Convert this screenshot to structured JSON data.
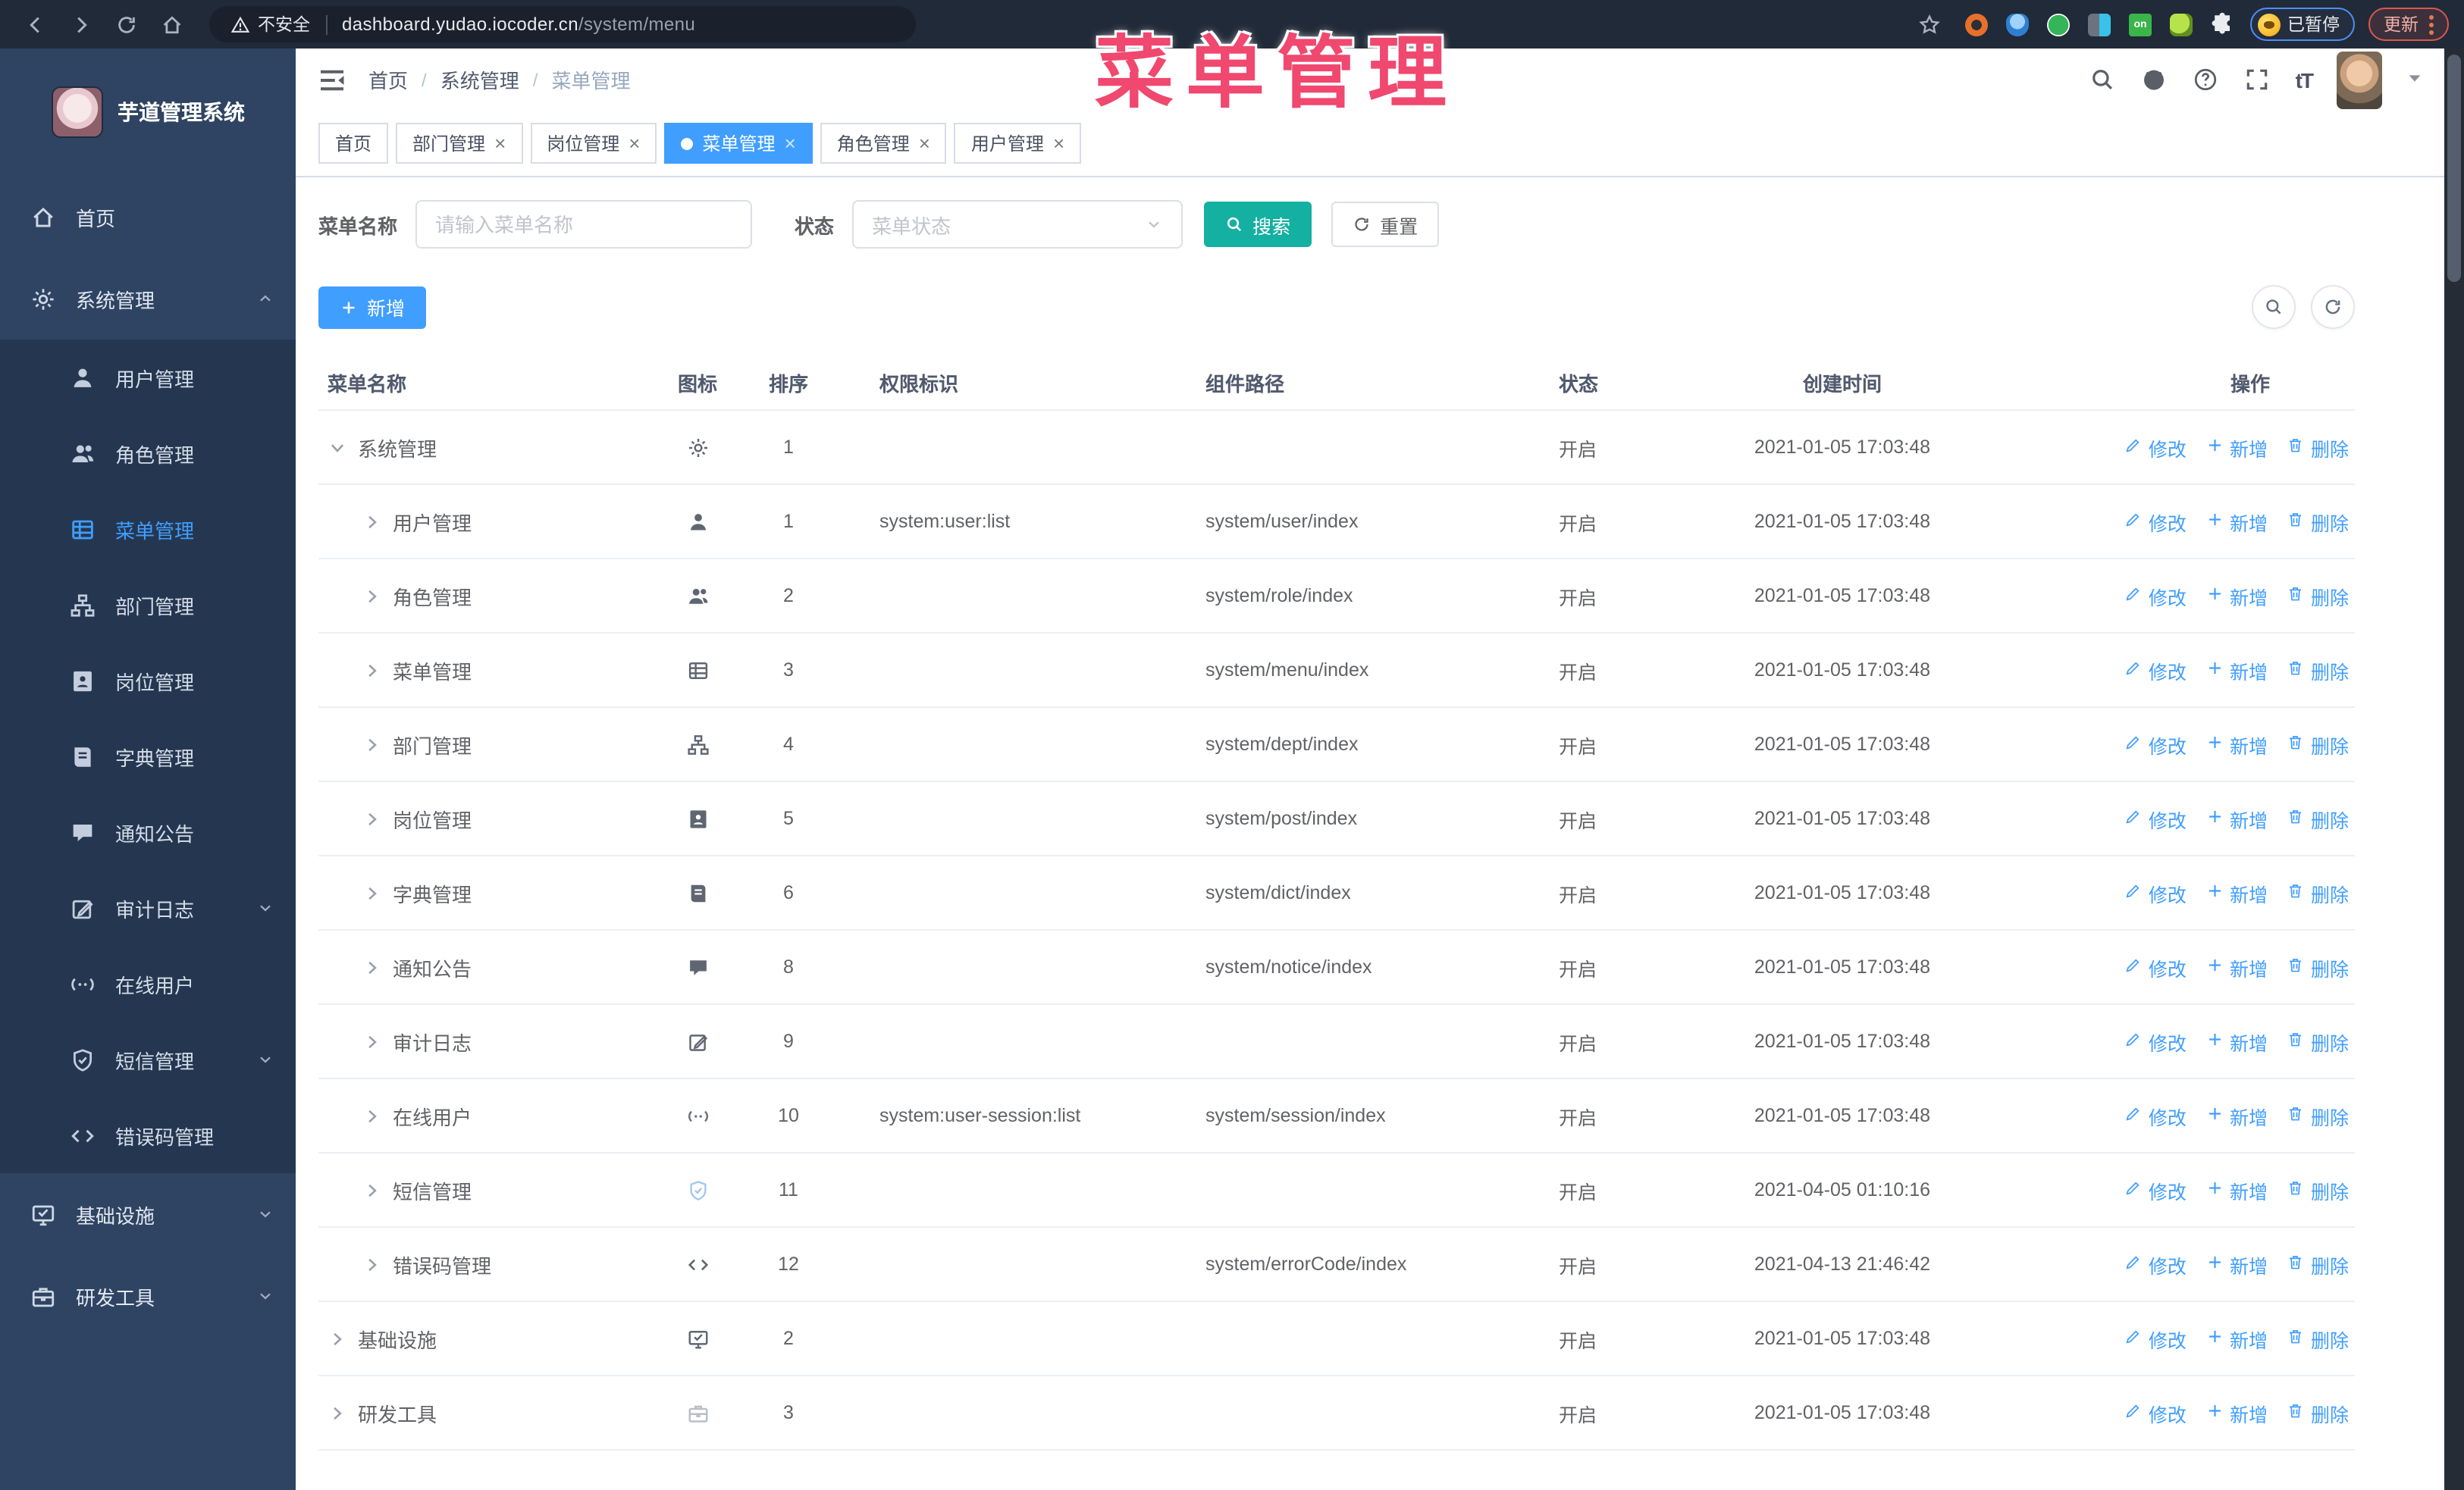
{
  "colors": {
    "accent": "#409eff",
    "teal": "#14b0a2",
    "annotation": "#f0486f",
    "sidebar": "#2f4462",
    "submenu": "#253750"
  },
  "browser": {
    "security_label": "不安全",
    "url_host": "dashboard.yudao.iocoder.cn",
    "url_path": "/system/menu",
    "paused_badge": "已暂停",
    "update_button": "更新"
  },
  "annotation": {
    "title": "菜单管理"
  },
  "sidebar": {
    "logo_title": "芋道管理系统",
    "items": [
      {
        "label": "首页",
        "icon": "home"
      },
      {
        "label": "系统管理",
        "icon": "gear",
        "expanded": true,
        "arrow": "up",
        "children": [
          {
            "label": "用户管理",
            "icon": "user"
          },
          {
            "label": "角色管理",
            "icon": "users"
          },
          {
            "label": "菜单管理",
            "icon": "menu",
            "active": true
          },
          {
            "label": "部门管理",
            "icon": "tree"
          },
          {
            "label": "岗位管理",
            "icon": "badge"
          },
          {
            "label": "字典管理",
            "icon": "book"
          },
          {
            "label": "通知公告",
            "icon": "message"
          },
          {
            "label": "审计日志",
            "icon": "edit",
            "arrow": "down"
          },
          {
            "label": "在线用户",
            "icon": "link"
          },
          {
            "label": "短信管理",
            "icon": "shield",
            "arrow": "down"
          },
          {
            "label": "错误码管理",
            "icon": "code"
          }
        ]
      },
      {
        "label": "基础设施",
        "icon": "monitor",
        "arrow": "down"
      },
      {
        "label": "研发工具",
        "icon": "tool",
        "arrow": "down"
      }
    ]
  },
  "header": {
    "breadcrumb": [
      "首页",
      "系统管理",
      "菜单管理"
    ],
    "right_icons": [
      "search-icon",
      "github-icon",
      "help-icon",
      "fullscreen-icon",
      "text-size-icon",
      "avatar",
      "caret-down-icon"
    ],
    "text_size_glyph": "tT"
  },
  "tabs": [
    {
      "label": "首页",
      "closable": false,
      "active": false
    },
    {
      "label": "部门管理",
      "closable": true,
      "active": false
    },
    {
      "label": "岗位管理",
      "closable": true,
      "active": false
    },
    {
      "label": "菜单管理",
      "closable": true,
      "active": true
    },
    {
      "label": "角色管理",
      "closable": true,
      "active": false
    },
    {
      "label": "用户管理",
      "closable": true,
      "active": false
    }
  ],
  "filters": {
    "name_label": "菜单名称",
    "name_placeholder": "请输入菜单名称",
    "status_label": "状态",
    "status_placeholder": "菜单状态",
    "search_label": "搜索",
    "reset_label": "重置"
  },
  "toolbar": {
    "add_label": "新增"
  },
  "table": {
    "columns": [
      "菜单名称",
      "图标",
      "排序",
      "权限标识",
      "组件路径",
      "状态",
      "创建时间",
      "操作"
    ],
    "actions": {
      "edit": "修改",
      "add": "新增",
      "delete": "删除"
    },
    "rows": [
      {
        "name": "系统管理",
        "icon": "gear",
        "indent": 0,
        "expander": "open",
        "sort": "1",
        "perm": "",
        "path": "",
        "status": "开启",
        "created": "2021-01-05 17:03:48"
      },
      {
        "name": "用户管理",
        "icon": "user",
        "indent": 1,
        "expander": "closed",
        "sort": "1",
        "perm": "system:user:list",
        "path": "system/user/index",
        "status": "开启",
        "created": "2021-01-05 17:03:48"
      },
      {
        "name": "角色管理",
        "icon": "users",
        "indent": 1,
        "expander": "closed",
        "sort": "2",
        "perm": "",
        "path": "system/role/index",
        "status": "开启",
        "created": "2021-01-05 17:03:48"
      },
      {
        "name": "菜单管理",
        "icon": "menu",
        "indent": 1,
        "expander": "closed",
        "sort": "3",
        "perm": "",
        "path": "system/menu/index",
        "status": "开启",
        "created": "2021-01-05 17:03:48"
      },
      {
        "name": "部门管理",
        "icon": "tree",
        "indent": 1,
        "expander": "closed",
        "sort": "4",
        "perm": "",
        "path": "system/dept/index",
        "status": "开启",
        "created": "2021-01-05 17:03:48"
      },
      {
        "name": "岗位管理",
        "icon": "badge",
        "indent": 1,
        "expander": "closed",
        "sort": "5",
        "perm": "",
        "path": "system/post/index",
        "status": "开启",
        "created": "2021-01-05 17:03:48"
      },
      {
        "name": "字典管理",
        "icon": "book",
        "indent": 1,
        "expander": "closed",
        "sort": "6",
        "perm": "",
        "path": "system/dict/index",
        "status": "开启",
        "created": "2021-01-05 17:03:48"
      },
      {
        "name": "通知公告",
        "icon": "message",
        "indent": 1,
        "expander": "closed",
        "sort": "8",
        "perm": "",
        "path": "system/notice/index",
        "status": "开启",
        "created": "2021-01-05 17:03:48"
      },
      {
        "name": "审计日志",
        "icon": "edit",
        "indent": 1,
        "expander": "closed",
        "sort": "9",
        "perm": "",
        "path": "",
        "status": "开启",
        "created": "2021-01-05 17:03:48"
      },
      {
        "name": "在线用户",
        "icon": "link",
        "indent": 1,
        "expander": "closed",
        "sort": "10",
        "perm": "system:user-session:list",
        "path": "system/session/index",
        "status": "开启",
        "created": "2021-01-05 17:03:48"
      },
      {
        "name": "短信管理",
        "icon": "shield",
        "indent": 1,
        "expander": "closed",
        "sort": "11",
        "perm": "",
        "path": "",
        "status": "开启",
        "created": "2021-04-05 01:10:16"
      },
      {
        "name": "错误码管理",
        "icon": "code",
        "indent": 1,
        "expander": "closed",
        "sort": "12",
        "perm": "",
        "path": "system/errorCode/index",
        "status": "开启",
        "created": "2021-04-13 21:46:42"
      },
      {
        "name": "基础设施",
        "icon": "monitor",
        "indent": 0,
        "expander": "closed",
        "sort": "2",
        "perm": "",
        "path": "",
        "status": "开启",
        "created": "2021-01-05 17:03:48"
      },
      {
        "name": "研发工具",
        "icon": "tool",
        "indent": 0,
        "expander": "closed",
        "sort": "3",
        "perm": "",
        "path": "",
        "status": "开启",
        "created": "2021-01-05 17:03:48"
      }
    ]
  }
}
